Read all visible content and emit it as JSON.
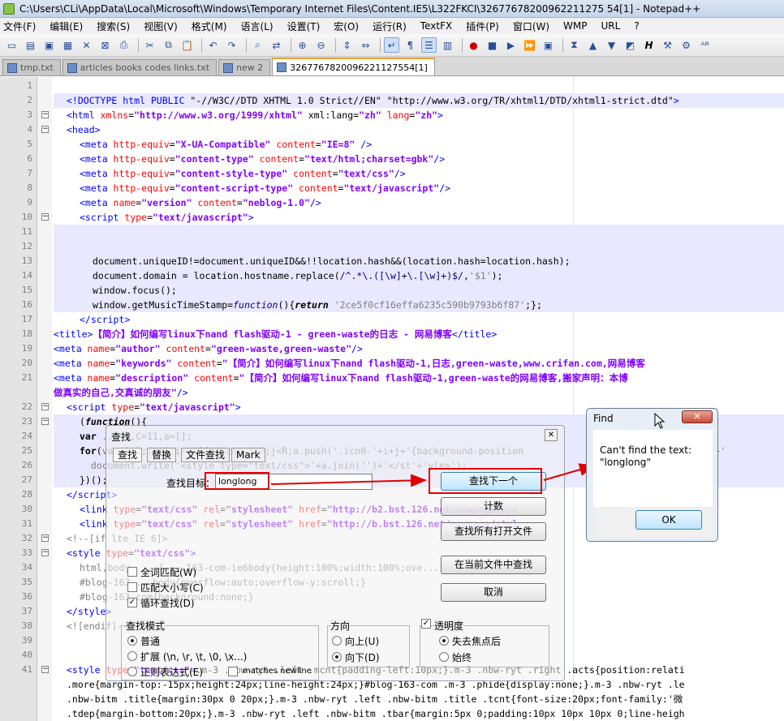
{
  "window": {
    "title": "C:\\Users\\CLi\\AppData\\Local\\Microsoft\\Windows\\Temporary Internet Files\\Content.IE5\\L322FKCI\\32677678200962211275 54[1] - Notepad++"
  },
  "menu": [
    "文件(F)",
    "编辑(E)",
    "搜索(S)",
    "视图(V)",
    "格式(M)",
    "语言(L)",
    "设置(T)",
    "宏(O)",
    "运行(R)",
    "TextFX",
    "插件(P)",
    "窗口(W)",
    "WMP",
    "URL",
    "?"
  ],
  "tabs": [
    {
      "label": "tmp.txt",
      "active": false
    },
    {
      "label": "articles books codes links.txt",
      "active": false
    },
    {
      "label": "new  2",
      "active": false
    },
    {
      "label": "3267767820096221127554[1]",
      "active": true
    }
  ],
  "lines": [
    {
      "n": "1",
      "fold": "",
      "html": ""
    },
    {
      "n": "2",
      "fold": "",
      "html": "<span class='t'>&lt;!DOCTYPE html PUBLIC </span><span class='c'>\"-//W3C//DTD XHTML 1.0 Strict//EN\" \"http://www.w3.org/TR/xhtml1/DTD/xhtml1-strict.dtd\"</span><span class='t'>&gt;</span>",
      "hl": true,
      "indent": 1
    },
    {
      "n": "3",
      "fold": "-",
      "html": "<span class='t'>&lt;html </span><span class='a'>xmlns</span><span class='c'>=</span><span class='v'>\"http://www.w3.org/1999/xhtml\"</span><span class='c'> xml:lang=</span><span class='v'>\"zh\"</span><span class='a'> lang</span><span class='c'>=</span><span class='v'>\"zh\"</span><span class='t'>&gt;</span>",
      "indent": 1
    },
    {
      "n": "4",
      "fold": "-",
      "html": "<span class='t'>&lt;head&gt;</span>",
      "indent": 1
    },
    {
      "n": "5",
      "fold": "",
      "html": "<span class='t'>&lt;meta </span><span class='a'>http-equiv</span>=<span class='v'>\"X-UA-Compatible\"</span> <span class='a'>content</span>=<span class='v'>\"IE=8\"</span> <span class='t'>/&gt;</span>",
      "indent": 2
    },
    {
      "n": "6",
      "fold": "",
      "html": "<span class='t'>&lt;meta </span><span class='a'>http-equiv</span>=<span class='v'>\"content-type\"</span> <span class='a'>content</span>=<span class='v'>\"text/html;charset=gbk\"</span><span class='t'>/&gt;</span>",
      "indent": 2
    },
    {
      "n": "7",
      "fold": "",
      "html": "<span class='t'>&lt;meta </span><span class='a'>http-equiv</span>=<span class='v'>\"content-style-type\"</span> <span class='a'>content</span>=<span class='v'>\"text/css\"</span><span class='t'>/&gt;</span>",
      "indent": 2
    },
    {
      "n": "8",
      "fold": "",
      "html": "<span class='t'>&lt;meta </span><span class='a'>http-equiv</span>=<span class='v'>\"content-script-type\"</span> <span class='a'>content</span>=<span class='v'>\"text/javascript\"</span><span class='t'>/&gt;</span>",
      "indent": 2
    },
    {
      "n": "9",
      "fold": "",
      "html": "<span class='t'>&lt;meta </span><span class='a'>name</span>=<span class='v'>\"version\"</span> <span class='a'>content</span>=<span class='v'>\"neblog-1.0\"</span><span class='t'>/&gt;</span>",
      "indent": 2
    },
    {
      "n": "10",
      "fold": "-",
      "html": "<span class='t'>&lt;script </span><span class='a'>type</span>=<span class='v'>\"text/javascript\"</span><span class='t'>&gt;</span>",
      "indent": 2
    },
    {
      "n": "11",
      "fold": "",
      "html": "",
      "hl": true
    },
    {
      "n": "12",
      "fold": "",
      "html": "",
      "hl": true
    },
    {
      "n": "13",
      "fold": "",
      "html": "document.uniqueID!=document.uniqueID&amp;&amp;!!location.hash&amp;&amp;(location.hash=location.hash);",
      "hl": true,
      "indent": 3
    },
    {
      "n": "14",
      "fold": "",
      "html": "document.domain = location.hostname.replace(<span class='k'>/^.*\\.([\\w]+\\.[\\w]+)$/</span>,<span class='s'>'$1'</span>);",
      "hl": true,
      "indent": 3
    },
    {
      "n": "15",
      "fold": "",
      "html": "window.focus();",
      "hl": true,
      "indent": 3
    },
    {
      "n": "16",
      "fold": "",
      "html": "window.getMusicTimeStamp=<i class='k'>function</i>(){<b><i>return</i></b> <span class='s'>'2ce5f0cf16effa6235c590b9793b6f87'</span>;};",
      "hl": true,
      "indent": 3
    },
    {
      "n": "17",
      "fold": "",
      "html": "<span class='t'>&lt;/script&gt;</span>",
      "indent": 2
    },
    {
      "n": "18",
      "fold": "",
      "html": "<span class='t'>&lt;title&gt;</span><span class='bold'>【简介】如何编写linux下nand flash驱动-1 - green-waste的日志 - 网易博客</span><span class='t'>&lt;/title&gt;</span>",
      "indent": 0
    },
    {
      "n": "19",
      "fold": "",
      "html": "<span class='t'>&lt;meta </span><span class='a'>name</span>=<span class='v'>\"author\"</span> <span class='a'>content</span>=<span class='v'>\"green-waste,green-waste\"</span><span class='t'>/&gt;</span>",
      "indent": 0
    },
    {
      "n": "20",
      "fold": "",
      "html": "<span class='t'>&lt;meta </span><span class='a'>name</span>=<span class='v'>\"keywords\"</span> <span class='a'>content</span>=<span class='v'>\"【简介】如何编写linux下nand flash驱动-1,日志,green-waste,www.crifan.com,网易博客</span>",
      "indent": 0
    },
    {
      "n": "21",
      "fold": "",
      "html": "<span class='t'>&lt;meta </span><span class='a'>name</span>=<span class='v'>\"description\"</span> <span class='a'>content</span>=<span class='v'>\"【简介】如何编写linux下nand flash驱动-1,green-waste的网易博客,搬家声明：本博</span>",
      "indent": 0
    },
    {
      "n": "",
      "fold": "",
      "html": "<span class='v'>做真实的自己,交真诚的朋友\"</span><span class='t'>/&gt;</span>",
      "indent": 0
    },
    {
      "n": "22",
      "fold": "-",
      "html": "<span class='t'>&lt;script </span><span class='a'>type</span>=<span class='v'>\"text/javascript\"</span><span class='t'>&gt;</span>",
      "indent": 1
    },
    {
      "n": "23",
      "fold": "-",
      "html": "(<b><i>function</i></b>(){",
      "hl": true,
      "indent": 2
    },
    {
      "n": "24",
      "fold": "",
      "html": "<b>var</b> <span class='s'>... 4,C=11,a=[];</span>",
      "hl": true,
      "indent": 2
    },
    {
      "n": "25",
      "fold": "",
      "html": "<b>for</b>(<span class='s'>var i=1;i&lt;=C;i++){for(var j=0;j&lt;R;a.push('.icn0-'+i+j+'{background-position</span>                          <span class='s'>x'):'0')+'</span>",
      "hl": true,
      "indent": 2
    },
    {
      "n": "26",
      "fold": "",
      "html": "<span class='s'>  document.write('&lt;style type=\"text/css\"&gt;'+a.join('')+'&lt;/st'+'yle&gt;');</span>",
      "hl": true,
      "indent": 2
    },
    {
      "n": "27",
      "fold": "",
      "html": "})();",
      "hl": true,
      "indent": 2
    },
    {
      "n": "28",
      "fold": "",
      "html": "<span class='t'>&lt;/script&gt;</span>",
      "indent": 1
    },
    {
      "n": "30",
      "fold": "",
      "html": "<span class='t'>&lt;link </span><span class='a'>type</span>=<span class='v'>\"text/css\"</span> <span class='a'>rel</span>=<span class='v'>\"stylesheet\"</span> <span class='a'>href</span>=<span class='v'>\"http://b2.bst.126.net/newpage/r/c</span>                        <span class='v'>50\"</span><span class='t'>/&gt;</span>",
      "indent": 2
    },
    {
      "n": "31",
      "fold": "",
      "html": "<span class='t'>&lt;link </span><span class='a'>type</span>=<span class='v'>\"text/css\"</span> <span class='a'>rel</span>=<span class='v'>\"stylesheet\"</span> <span class='a'>href</span>=<span class='v'>\"http://b.bst.126.net/newpage/styl</span>                        <span class='a'>id</span>=<span class='v'>\"blog-</span>",
      "indent": 2
    },
    {
      "n": "32",
      "fold": "-",
      "html": "<span class='s'>&lt;!--[if lte IE 6]&gt;</span>",
      "indent": 1
    },
    {
      "n": "33",
      "fold": "-",
      "html": "<span class='t'>&lt;style </span><span class='a'>type</span>=<span class='v'>\"text/css\"</span><span class='t'>&gt;</span>",
      "indent": 1
    },
    {
      "n": "34",
      "fold": "",
      "html": "<span class='s'>html,body, ...{ ...163-com-ie6body{height:100%;width:100%;ove...</span>",
      "indent": 2
    },
    {
      "n": "35",
      "fold": "",
      "html": "<span class='s'>#blog-163-...body{overflow:auto;overflow-y:scroll;}</span>",
      "indent": 2
    },
    {
      "n": "36",
      "fold": "",
      "html": "<span class='s'>#blog-163-com{background:none;}</span>",
      "indent": 2
    },
    {
      "n": "37",
      "fold": "",
      "html": "<span class='t'>&lt;/style&gt;</span>",
      "indent": 1
    },
    {
      "n": "38",
      "fold": "",
      "html": "<span class='s'>&lt;![endif]--&gt;</span>",
      "indent": 1
    },
    {
      "n": "39",
      "fold": "",
      "html": "",
      "indent": 0
    },
    {
      "n": "40",
      "fold": "",
      "html": "",
      "indent": 0
    },
    {
      "n": "41",
      "fold": "-",
      "html": "<span class='t'>&lt;style </span><span class='a'>type</span>=<span class='v'>\"text/css\"</span><span class='t'>&gt;</span>.m-3 .nbw-ryt .left .mcnt{padding-left:10px;}.m-3 .nbw-ryt .right .acts{position:relati</span>",
      "indent": 1
    },
    {
      "n": "",
      "fold": "",
      "html": ".more{margin-top:-15px;height:24px;line-height:24px;}#blog-163-com .m-3 .phide{display:none;}.m-3 .nbw-ryt .le",
      "indent": 1
    },
    {
      "n": "",
      "fold": "",
      "html": ".nbw-bitm .title{margin:30px 0 20px;}.m-3 .nbw-ryt .left .nbw-bitm .title .tcnt{font-size:20px;font-family:'微",
      "indent": 1
    },
    {
      "n": "",
      "fold": "",
      "html": ".tdep{margin-bottom:20px;}.m-3 .nbw-ryt .left .nbw-bitm .tbar{margin:5px 0;padding:10px 10px 10px 0;line-heigh",
      "indent": 1
    }
  ],
  "find": {
    "title": "查找",
    "tabs": [
      "查找",
      "替换",
      "文件查找",
      "Mark"
    ],
    "target_label": "查找目标：",
    "target_value": "longlong",
    "buttons": {
      "find_next": "查找下一个",
      "count": "计数",
      "find_all_open": "查找所有打开文件",
      "find_in_current": "在当前文件中查找",
      "cancel": "取消"
    },
    "options": {
      "whole_word": "全词匹配(W)",
      "match_case": "匹配大小写(C)",
      "wrap": "循环查找(D)"
    },
    "mode": {
      "title": "查找模式",
      "normal": "普通",
      "extended": "扩展 (\\n, \\r, \\t, \\0, \\x...)",
      "regex": "正则表达式(E)",
      "newline": "matches newline"
    },
    "direction": {
      "title": "方向",
      "up": "向上(U)",
      "down": "向下(D)"
    },
    "transparency": {
      "title": "透明度",
      "on_lose_focus": "失去焦点后",
      "always": "始终"
    }
  },
  "alert": {
    "title": "Find",
    "line1": "Can't find the text:",
    "line2": "\"longlong\"",
    "ok": "OK"
  },
  "colors": {
    "highlight_box": "#e00000",
    "accent": "#3c7fb1"
  }
}
